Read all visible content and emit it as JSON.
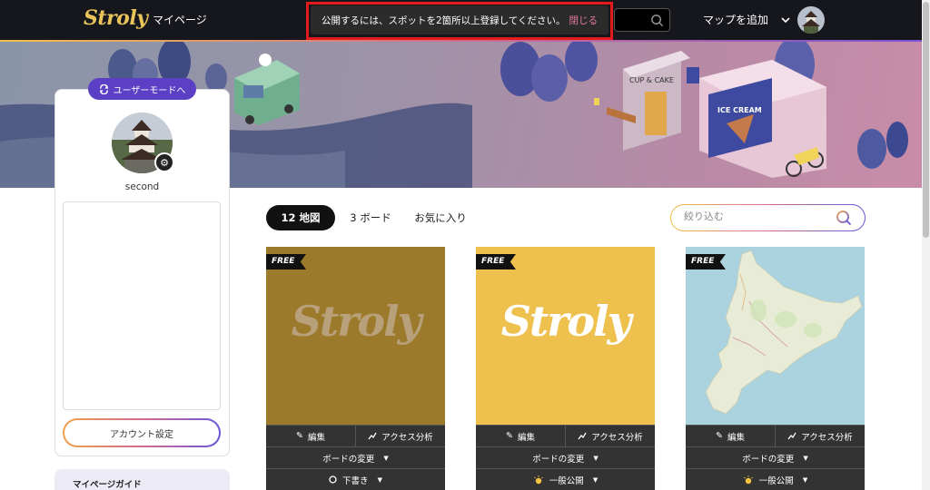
{
  "header": {
    "logo": "Stroly",
    "mypage": "マイページ",
    "add_map": "マップを追加"
  },
  "toast": {
    "message": "公開するには、スポットを2箇所以上登録してください。",
    "close": "閉じる"
  },
  "profile": {
    "user_mode_button": "ユーザーモードへ",
    "username": "second",
    "account_settings": "アカウント設定",
    "guide": "マイページガイド"
  },
  "tabs": [
    {
      "label": "12 地図",
      "active": true
    },
    {
      "label": "3 ボード",
      "active": false
    },
    {
      "label": "お気に入り",
      "active": false
    }
  ],
  "filter": {
    "placeholder": "絞り込む"
  },
  "cards": [
    {
      "badge": "FREE",
      "thumb_logo": "Stroly",
      "edit": "編集",
      "analytics": "アクセス分析",
      "board_change": "ボードの変更",
      "status": "下書き",
      "status_icon": "circle-outline",
      "bg": "#9c7a2c",
      "logo_color": "#b8a07a"
    },
    {
      "badge": "FREE",
      "thumb_logo": "Stroly",
      "edit": "編集",
      "analytics": "アクセス分析",
      "board_change": "ボードの変更",
      "status": "一般公開",
      "status_icon": "sun",
      "bg": "#eec04e",
      "logo_color": "#ffffff"
    },
    {
      "badge": "FREE",
      "thumb_logo": "",
      "edit": "編集",
      "analytics": "アクセス分析",
      "board_change": "ボードの変更",
      "status": "一般公開",
      "status_icon": "sun",
      "bg": "#abd3df",
      "logo_color": ""
    }
  ]
}
